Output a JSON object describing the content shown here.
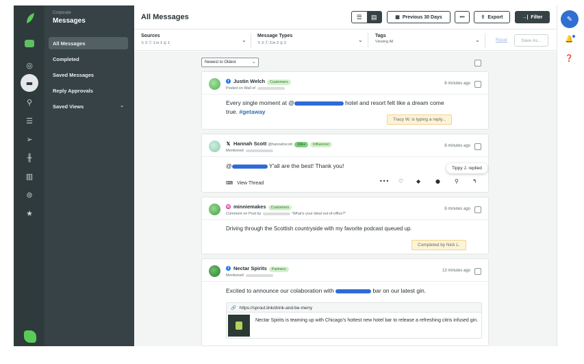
{
  "subnav": {
    "kicker": "Corporate",
    "title": "Messages",
    "items": [
      "All Messages",
      "Completed",
      "Saved Messages",
      "Reply Approvals",
      "Saved Views"
    ]
  },
  "header": {
    "title": "All Messages",
    "date_range": "Previous 30 Days",
    "more": "•••",
    "export": "Export",
    "filter": "Filter"
  },
  "filters": {
    "sources": {
      "label": "Sources",
      "counts": "𝕏 2  ⓕ 1  in 1  ◎ 1"
    },
    "types": {
      "label": "Message Types",
      "counts": "𝕏 3  ⓕ 3  in 2  ◎ 2"
    },
    "tags": {
      "label": "Tags",
      "value": "Viewing All"
    },
    "reset": "Reset",
    "save_as": "Save As..."
  },
  "sort": {
    "value": "Newest to Oldest"
  },
  "cards": [
    {
      "name": "Justin Welch",
      "tag": "Customers",
      "meta": "Posted on Wall of",
      "time": "8 minutes ago",
      "text_before": "Every single moment at @",
      "text_after": " hotel and resort felt like a dream come",
      "text_line2": "true. ",
      "hashtag": "#getaway",
      "typing": "Tracy W. is typing a reply..."
    },
    {
      "name": "Hannah Scott",
      "handle": "@hannahscott",
      "badge": "10k+",
      "tag": "Influencer",
      "meta": "Mentioned",
      "time": "8 minutes ago",
      "text_before": "@",
      "text_after": " Y'all are the best! Thank you!",
      "view_thread": "View Thread",
      "tooltip": "Tippy J. replied"
    },
    {
      "name": "minniemakes",
      "tag": "Customers",
      "meta": "Comment on Post by",
      "meta_quote": "\"What's your ideal out-of-office?\"",
      "time": "8 minutes ago",
      "text": "Driving through the Scottish countryside with my favorite podcast queued up.",
      "completed": "Completed by Nick L."
    },
    {
      "name": "Nectar Spirits",
      "tag": "Partners",
      "meta": "Mentioned",
      "time": "13 minutes ago",
      "text_before": "Excited to announce our colaboration with ",
      "text_after": " bar on our latest gin.",
      "link_url": "https://sprout.link/drink-and-be-merry",
      "link_text": "Nectar Spirits is teaming up with Chicago's hottest new hotel bar to release a refreshing citris infused gin."
    }
  ],
  "colors": {
    "accent": "#2e6fd1",
    "rail": "#2f3a3c",
    "brand": "#59cb59"
  }
}
